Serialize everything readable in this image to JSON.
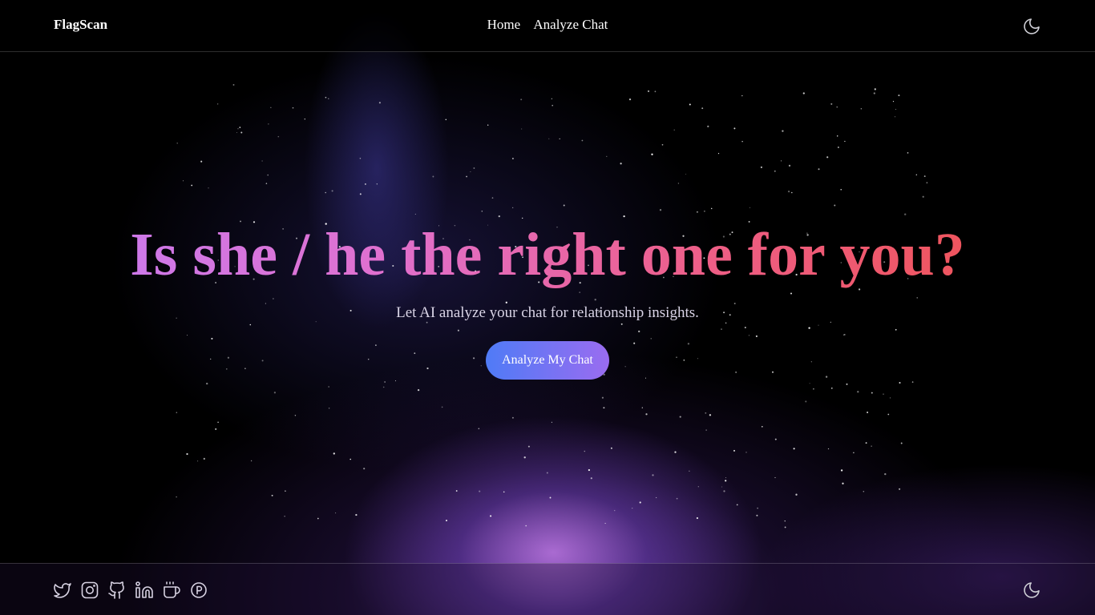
{
  "brand": "FlagScan",
  "nav": {
    "items": [
      "Home",
      "Analyze Chat"
    ]
  },
  "hero": {
    "title": "Is she / he the right one for you?",
    "subtitle": "Let AI analyze your chat for relationship insights.",
    "cta_label": "Analyze My Chat"
  },
  "header": {
    "theme_toggle_icon": "moon-icon"
  },
  "footer": {
    "social_icons": [
      "twitter-icon",
      "instagram-icon",
      "github-icon",
      "linkedin-icon",
      "coffee-icon",
      "patreon-icon"
    ],
    "theme_toggle_icon": "moon-icon"
  },
  "colors": {
    "title_gradient": [
      "#c47cf5",
      "#e070cf",
      "#ee5e86",
      "#f0504a"
    ],
    "button_gradient": [
      "#4f7bf6",
      "#9a6cf0"
    ],
    "background": "#000000"
  }
}
